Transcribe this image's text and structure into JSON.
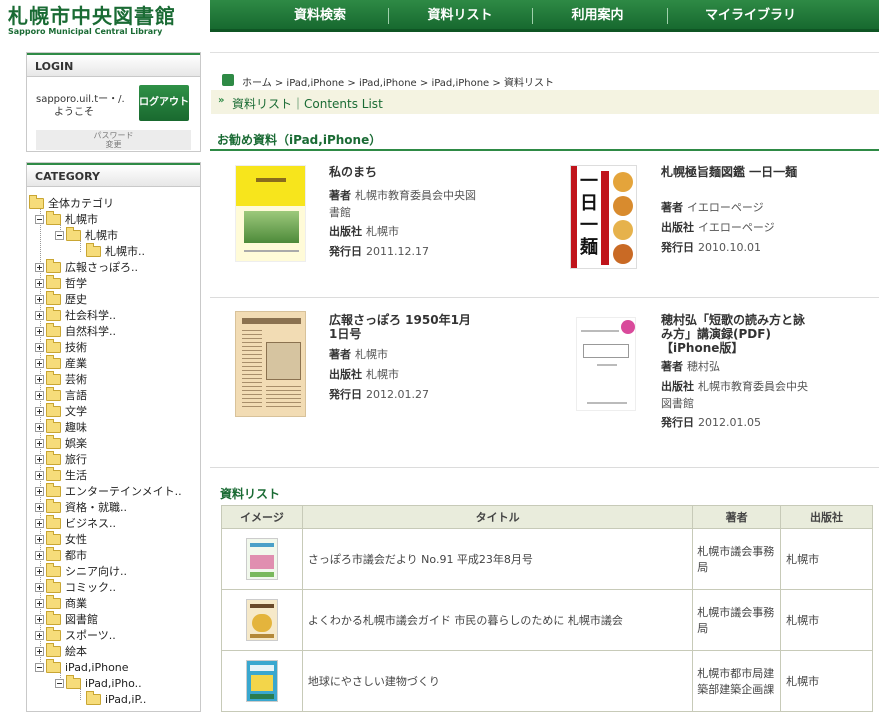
{
  "header": {
    "logo_title": "札幌市中央図書館",
    "logo_subtitle": "Sapporo Municipal Central Library",
    "nav": [
      "資料検索",
      "資料リスト",
      "利用案内",
      "マイライブラリ"
    ]
  },
  "login": {
    "heading": "LOGIN",
    "user_name": "sapporo.uil.tー・/.",
    "welcome": "ようこそ",
    "logout_label": "ログアウト",
    "password_line1": "パスワード",
    "password_line2": "変更"
  },
  "category": {
    "heading": "CATEGORY",
    "tree": [
      "全体カテゴリ",
      "札幌市",
      "札幌市",
      "札幌市..",
      "広報さっぽろ..",
      "哲学",
      "歴史",
      "社会科学..",
      "自然科学..",
      "技術",
      "産業",
      "芸術",
      "言語",
      "文学",
      "趣味",
      "娯楽",
      "旅行",
      "生活",
      "エンターテインメイト..",
      "資格・就職..",
      "ビジネス..",
      "女性",
      "都市",
      "シニア向け..",
      "コミック..",
      "商業",
      "図書館",
      "スポーツ..",
      "絵本",
      "iPad,iPhone",
      "iPad,iPho..",
      "iPad,iP.."
    ]
  },
  "breadcrumb": "ホーム > iPad,iPhone > iPad,iPhone > iPad,iPhone > 資料リスト",
  "page_title": "資料リスト｜Contents List",
  "recommended": {
    "heading": "お勧め資料（iPad,iPhone）",
    "label_author": "著者",
    "label_publisher": "出版社",
    "label_date": "発行日",
    "books": [
      {
        "title": "私のまち",
        "author": "札幌市教育委員会中央図書館",
        "publisher": "札幌市",
        "date": "2011.12.17"
      },
      {
        "title": "札幌極旨麺図鑑 一日一麺",
        "author": "イエローページ",
        "publisher": "イエローページ",
        "date": "2010.10.01"
      },
      {
        "title": "広報さっぽろ 1950年1月1日号",
        "author": "札幌市",
        "publisher": "札幌市",
        "date": "2012.01.27"
      },
      {
        "title": "穂村弘「短歌の読み方と詠み方」講演録(PDF)【iPhone版】",
        "author": "穂村弘",
        "publisher": "札幌市教育委員会中央図書館",
        "date": "2012.01.05"
      }
    ]
  },
  "list": {
    "heading": "資料リスト",
    "columns": [
      "イメージ",
      "タイトル",
      "著者",
      "出版社"
    ],
    "rows": [
      {
        "title": "さっぽろ市議会だより No.91 平成23年8月号",
        "author": "札幌市議会事務局",
        "publisher": "札幌市"
      },
      {
        "title": "よくわかる札幌市議会ガイド 市民の暮らしのために 札幌市議会",
        "author": "札幌市議会事務局",
        "publisher": "札幌市"
      },
      {
        "title": "地球にやさしい建物づくり",
        "author": "札幌市都市局建築部建築企画課",
        "publisher": "札幌市"
      }
    ]
  },
  "colors": {
    "brand_green": "#1a6b34",
    "nav_green": "#2e8a45",
    "banner_bg": "#f4f3e1"
  }
}
